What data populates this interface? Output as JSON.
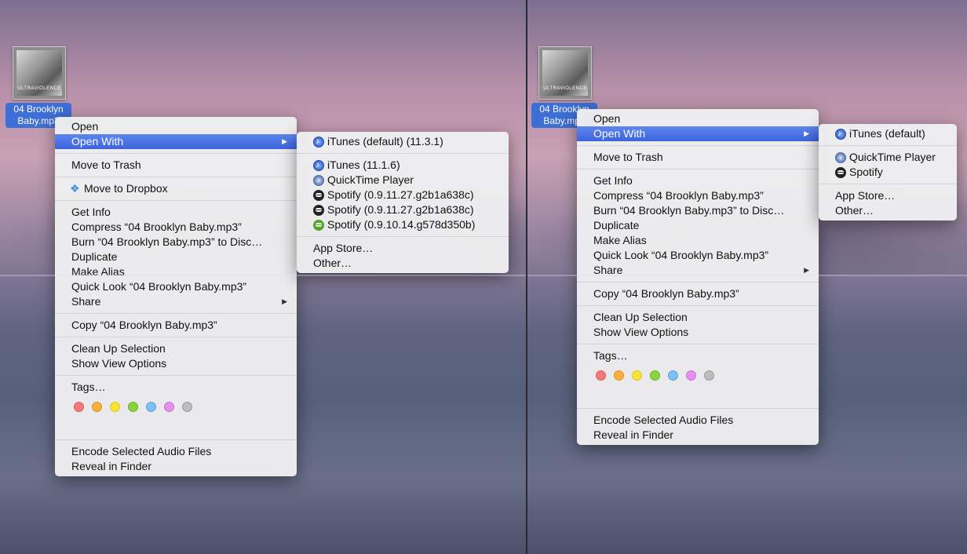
{
  "file": {
    "label_line1": "04 Brooklyn",
    "label_line2": "Baby.mp3",
    "art_text": "ULTRAVIOLENCE"
  },
  "left": {
    "menu": {
      "open": "Open",
      "open_with": "Open With",
      "move_to_trash": "Move to Trash",
      "move_to_dropbox": "Move to Dropbox",
      "get_info": "Get Info",
      "compress": "Compress “04 Brooklyn Baby.mp3”",
      "burn": "Burn “04 Brooklyn Baby.mp3” to Disc…",
      "duplicate": "Duplicate",
      "make_alias": "Make Alias",
      "quick_look": "Quick Look “04 Brooklyn Baby.mp3”",
      "share": "Share",
      "copy": "Copy “04 Brooklyn Baby.mp3”",
      "clean_up": "Clean Up Selection",
      "show_view_options": "Show View Options",
      "tags": "Tags…",
      "encode": "Encode Selected Audio Files",
      "reveal": "Reveal in Finder"
    },
    "submenu": {
      "default_app": "iTunes (default) (11.3.1)",
      "apps": [
        {
          "label": "iTunes (11.1.6)",
          "icon": "itunes-icon"
        },
        {
          "label": "QuickTime Player",
          "icon": "quicktime-icon"
        },
        {
          "label": "Spotify (0.9.11.27.g2b1a638c)",
          "icon": "spotify-icon"
        },
        {
          "label": "Spotify (0.9.11.27.g2b1a638c)",
          "icon": "spotify-icon"
        },
        {
          "label": "Spotify (0.9.10.14.g578d350b)",
          "icon": "spotify-green-icon"
        }
      ],
      "app_store": "App Store…",
      "other": "Other…"
    }
  },
  "right": {
    "menu": {
      "open": "Open",
      "open_with": "Open With",
      "move_to_trash": "Move to Trash",
      "get_info": "Get Info",
      "compress": "Compress “04 Brooklyn Baby.mp3”",
      "burn": "Burn “04 Brooklyn Baby.mp3” to Disc…",
      "duplicate": "Duplicate",
      "make_alias": "Make Alias",
      "quick_look": "Quick Look “04 Brooklyn Baby.mp3”",
      "share": "Share",
      "copy": "Copy “04 Brooklyn Baby.mp3”",
      "clean_up": "Clean Up Selection",
      "show_view_options": "Show View Options",
      "tags": "Tags…",
      "encode": "Encode Selected Audio Files",
      "reveal": "Reveal in Finder"
    },
    "submenu": {
      "default_app": "iTunes (default)",
      "apps": [
        {
          "label": "QuickTime Player",
          "icon": "quicktime-icon"
        },
        {
          "label": "Spotify",
          "icon": "spotify-icon"
        }
      ],
      "app_store": "App Store…",
      "other": "Other…"
    }
  },
  "tag_colors": [
    {
      "name": "red",
      "fill": "#f07a7a",
      "stroke": "#d85c5c"
    },
    {
      "name": "orange",
      "fill": "#f5b03e",
      "stroke": "#d99424"
    },
    {
      "name": "yellow",
      "fill": "#f6e43b",
      "stroke": "#d8c423"
    },
    {
      "name": "green",
      "fill": "#8bd33a",
      "stroke": "#6db423"
    },
    {
      "name": "blue",
      "fill": "#7fbff2",
      "stroke": "#5ea2dc"
    },
    {
      "name": "purple",
      "fill": "#e58ff0",
      "stroke": "#c96fd6"
    },
    {
      "name": "gray",
      "fill": "#bdbdbd",
      "stroke": "#9b9b9b"
    }
  ],
  "accent_color": "#3e63dd"
}
